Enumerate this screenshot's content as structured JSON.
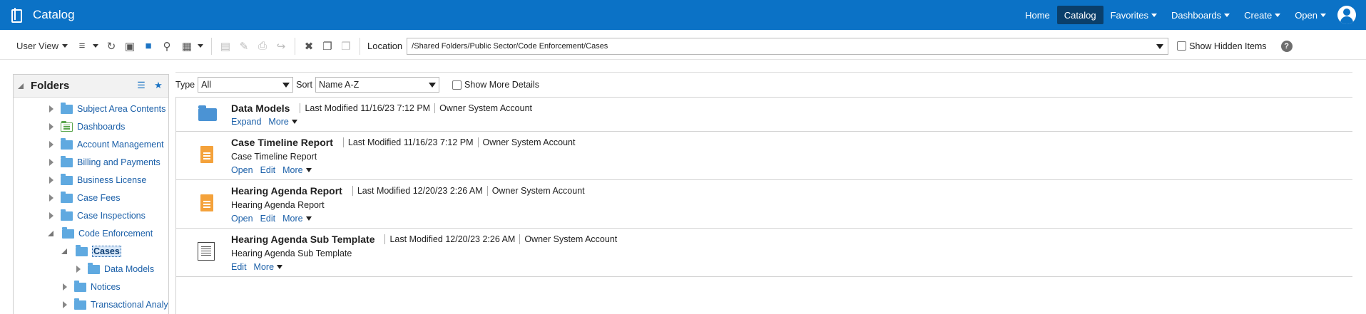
{
  "header": {
    "app_title": "Catalog",
    "nav": [
      {
        "label": "Home",
        "dropdown": false,
        "active": false
      },
      {
        "label": "Catalog",
        "dropdown": false,
        "active": true
      },
      {
        "label": "Favorites",
        "dropdown": true,
        "active": false
      },
      {
        "label": "Dashboards",
        "dropdown": true,
        "active": false
      },
      {
        "label": "Create",
        "dropdown": true,
        "active": false
      },
      {
        "label": "Open",
        "dropdown": true,
        "active": false
      }
    ],
    "accent": "#0b72c6"
  },
  "toolbar": {
    "user_view_label": "User View",
    "location_label": "Location",
    "location_value": "/Shared Folders/Public Sector/Code Enforcement/Cases",
    "show_hidden_label": "Show Hidden Items",
    "help_label": "?",
    "icons": [
      "sort-icon",
      "refresh-icon",
      "new-folder-icon",
      "open-folder-icon",
      "search-icon",
      "grid-view-icon",
      "upload-icon",
      "edit-icon",
      "print-icon",
      "share-icon",
      "delete-icon",
      "copy-icon",
      "paste-icon"
    ]
  },
  "folders_panel": {
    "title": "Folders",
    "items": [
      {
        "label": "Subject Area Contents",
        "level": 2,
        "state": "collapsed",
        "icon": "folder"
      },
      {
        "label": "Dashboards",
        "level": 2,
        "state": "collapsed",
        "icon": "dashboard-folder"
      },
      {
        "label": "Account Management",
        "level": 2,
        "state": "collapsed",
        "icon": "folder"
      },
      {
        "label": "Billing and Payments",
        "level": 2,
        "state": "collapsed",
        "icon": "folder"
      },
      {
        "label": "Business License",
        "level": 2,
        "state": "collapsed",
        "icon": "folder"
      },
      {
        "label": "Case Fees",
        "level": 2,
        "state": "collapsed",
        "icon": "folder"
      },
      {
        "label": "Case Inspections",
        "level": 2,
        "state": "collapsed",
        "icon": "folder"
      },
      {
        "label": "Code Enforcement",
        "level": 2,
        "state": "expanded",
        "icon": "folder"
      },
      {
        "label": "Cases",
        "level": 3,
        "state": "expanded",
        "icon": "folder",
        "selected": true
      },
      {
        "label": "Data Models",
        "level": 4,
        "state": "collapsed",
        "icon": "folder"
      },
      {
        "label": "Notices",
        "level": 3,
        "state": "collapsed",
        "icon": "folder"
      },
      {
        "label": "Transactional Analysis",
        "level": 3,
        "state": "collapsed",
        "icon": "folder"
      }
    ]
  },
  "filters": {
    "type_label": "Type",
    "type_value": "All",
    "sort_label": "Sort",
    "sort_value": "Name A-Z",
    "show_more_label": "Show More Details"
  },
  "items": [
    {
      "name": "Data Models",
      "modified_label": "Last Modified",
      "modified": "11/16/23 7:12 PM",
      "owner_label": "Owner",
      "owner": "System Account",
      "description": "",
      "actions": [
        "Expand"
      ],
      "more_label": "More",
      "icon": "folder-icon"
    },
    {
      "name": "Case Timeline Report",
      "modified_label": "Last Modified",
      "modified": "11/16/23 7:12 PM",
      "owner_label": "Owner",
      "owner": "System Account",
      "description": "Case Timeline Report",
      "actions": [
        "Open",
        "Edit"
      ],
      "more_label": "More",
      "icon": "report-icon"
    },
    {
      "name": "Hearing Agenda Report",
      "modified_label": "Last Modified",
      "modified": "12/20/23 2:26 AM",
      "owner_label": "Owner",
      "owner": "System Account",
      "description": "Hearing Agenda Report",
      "actions": [
        "Open",
        "Edit"
      ],
      "more_label": "More",
      "icon": "report-icon"
    },
    {
      "name": "Hearing Agenda Sub Template",
      "modified_label": "Last Modified",
      "modified": "12/20/23 2:26 AM",
      "owner_label": "Owner",
      "owner": "System Account",
      "description": "Hearing Agenda Sub Template",
      "actions": [
        "Edit"
      ],
      "more_label": "More",
      "icon": "sub-template-icon"
    }
  ]
}
